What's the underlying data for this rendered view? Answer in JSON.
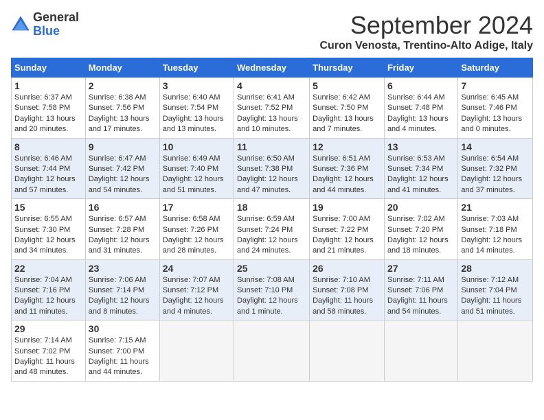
{
  "logo": {
    "general": "General",
    "blue": "Blue"
  },
  "title": "September 2024",
  "location": "Curon Venosta, Trentino-Alto Adige, Italy",
  "days_of_week": [
    "Sunday",
    "Monday",
    "Tuesday",
    "Wednesday",
    "Thursday",
    "Friday",
    "Saturday"
  ],
  "weeks": [
    [
      {
        "day": "1",
        "sunrise": "6:37 AM",
        "sunset": "7:58 PM",
        "daylight": "13 hours and 20 minutes."
      },
      {
        "day": "2",
        "sunrise": "6:38 AM",
        "sunset": "7:56 PM",
        "daylight": "13 hours and 17 minutes."
      },
      {
        "day": "3",
        "sunrise": "6:40 AM",
        "sunset": "7:54 PM",
        "daylight": "13 hours and 13 minutes."
      },
      {
        "day": "4",
        "sunrise": "6:41 AM",
        "sunset": "7:52 PM",
        "daylight": "13 hours and 10 minutes."
      },
      {
        "day": "5",
        "sunrise": "6:42 AM",
        "sunset": "7:50 PM",
        "daylight": "13 hours and 7 minutes."
      },
      {
        "day": "6",
        "sunrise": "6:44 AM",
        "sunset": "7:48 PM",
        "daylight": "13 hours and 4 minutes."
      },
      {
        "day": "7",
        "sunrise": "6:45 AM",
        "sunset": "7:46 PM",
        "daylight": "13 hours and 0 minutes."
      }
    ],
    [
      {
        "day": "8",
        "sunrise": "6:46 AM",
        "sunset": "7:44 PM",
        "daylight": "12 hours and 57 minutes."
      },
      {
        "day": "9",
        "sunrise": "6:47 AM",
        "sunset": "7:42 PM",
        "daylight": "12 hours and 54 minutes."
      },
      {
        "day": "10",
        "sunrise": "6:49 AM",
        "sunset": "7:40 PM",
        "daylight": "12 hours and 51 minutes."
      },
      {
        "day": "11",
        "sunrise": "6:50 AM",
        "sunset": "7:38 PM",
        "daylight": "12 hours and 47 minutes."
      },
      {
        "day": "12",
        "sunrise": "6:51 AM",
        "sunset": "7:36 PM",
        "daylight": "12 hours and 44 minutes."
      },
      {
        "day": "13",
        "sunrise": "6:53 AM",
        "sunset": "7:34 PM",
        "daylight": "12 hours and 41 minutes."
      },
      {
        "day": "14",
        "sunrise": "6:54 AM",
        "sunset": "7:32 PM",
        "daylight": "12 hours and 37 minutes."
      }
    ],
    [
      {
        "day": "15",
        "sunrise": "6:55 AM",
        "sunset": "7:30 PM",
        "daylight": "12 hours and 34 minutes."
      },
      {
        "day": "16",
        "sunrise": "6:57 AM",
        "sunset": "7:28 PM",
        "daylight": "12 hours and 31 minutes."
      },
      {
        "day": "17",
        "sunrise": "6:58 AM",
        "sunset": "7:26 PM",
        "daylight": "12 hours and 28 minutes."
      },
      {
        "day": "18",
        "sunrise": "6:59 AM",
        "sunset": "7:24 PM",
        "daylight": "12 hours and 24 minutes."
      },
      {
        "day": "19",
        "sunrise": "7:00 AM",
        "sunset": "7:22 PM",
        "daylight": "12 hours and 21 minutes."
      },
      {
        "day": "20",
        "sunrise": "7:02 AM",
        "sunset": "7:20 PM",
        "daylight": "12 hours and 18 minutes."
      },
      {
        "day": "21",
        "sunrise": "7:03 AM",
        "sunset": "7:18 PM",
        "daylight": "12 hours and 14 minutes."
      }
    ],
    [
      {
        "day": "22",
        "sunrise": "7:04 AM",
        "sunset": "7:16 PM",
        "daylight": "12 hours and 11 minutes."
      },
      {
        "day": "23",
        "sunrise": "7:06 AM",
        "sunset": "7:14 PM",
        "daylight": "12 hours and 8 minutes."
      },
      {
        "day": "24",
        "sunrise": "7:07 AM",
        "sunset": "7:12 PM",
        "daylight": "12 hours and 4 minutes."
      },
      {
        "day": "25",
        "sunrise": "7:08 AM",
        "sunset": "7:10 PM",
        "daylight": "12 hours and 1 minute."
      },
      {
        "day": "26",
        "sunrise": "7:10 AM",
        "sunset": "7:08 PM",
        "daylight": "11 hours and 58 minutes."
      },
      {
        "day": "27",
        "sunrise": "7:11 AM",
        "sunset": "7:06 PM",
        "daylight": "11 hours and 54 minutes."
      },
      {
        "day": "28",
        "sunrise": "7:12 AM",
        "sunset": "7:04 PM",
        "daylight": "11 hours and 51 minutes."
      }
    ],
    [
      {
        "day": "29",
        "sunrise": "7:14 AM",
        "sunset": "7:02 PM",
        "daylight": "11 hours and 48 minutes."
      },
      {
        "day": "30",
        "sunrise": "7:15 AM",
        "sunset": "7:00 PM",
        "daylight": "11 hours and 44 minutes."
      },
      null,
      null,
      null,
      null,
      null
    ]
  ]
}
